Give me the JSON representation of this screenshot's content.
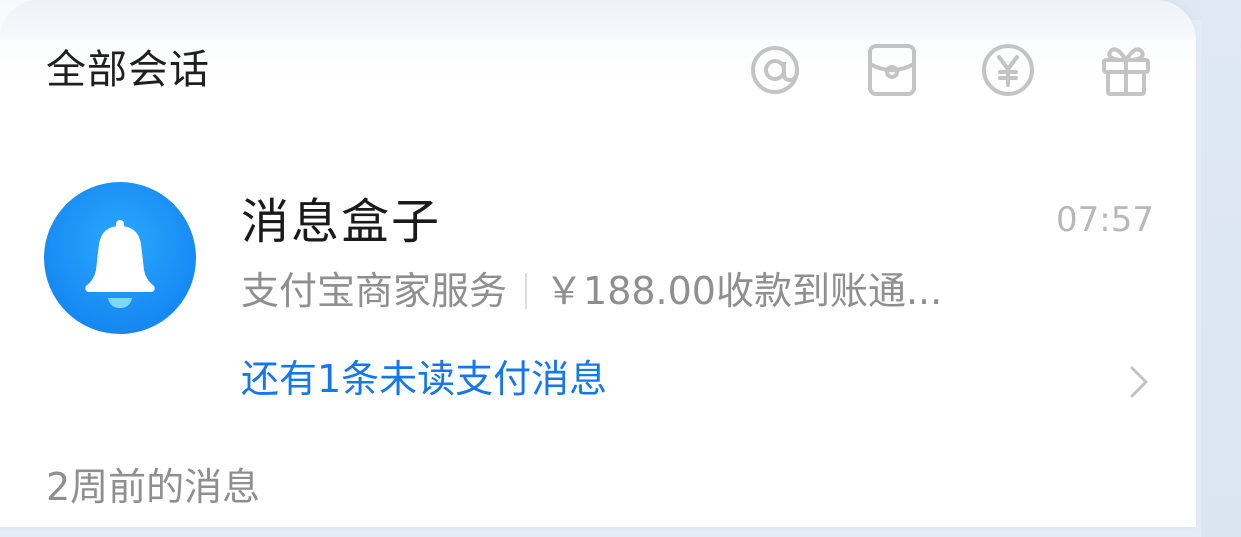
{
  "header": {
    "title": "全部会话",
    "icons": [
      "at-icon",
      "red-packet-icon",
      "yuan-icon",
      "gift-icon"
    ]
  },
  "conversation": {
    "title": "消息盒子",
    "time": "07:57",
    "sender": "支付宝商家服务",
    "preview": "￥188.00收款到账通...",
    "unread_link": "还有1条未读支付消息",
    "avatar_icon": "bell-icon",
    "accent_color": "#1677e8"
  },
  "section": {
    "label": "2周前的消息"
  }
}
